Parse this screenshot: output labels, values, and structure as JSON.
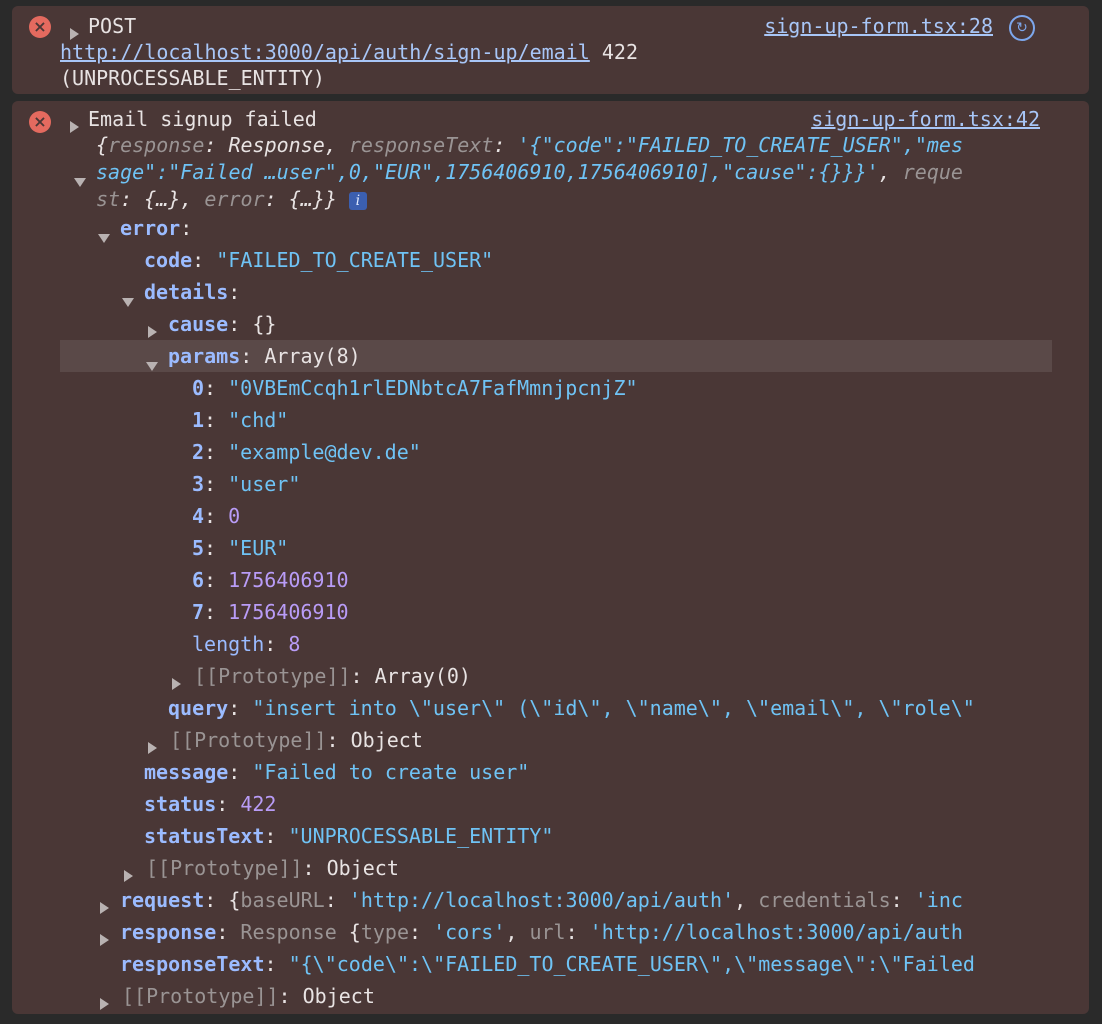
{
  "entries": [
    {
      "method": "POST",
      "source": "sign-up-form.tsx:28",
      "url": "http://localhost:3000/api/auth/sign-up/email",
      "status_code": "422",
      "status_text": "(UNPROCESSABLE_ENTITY)"
    },
    {
      "message": "Email signup failed",
      "source": "sign-up-form.tsx:42",
      "summary": {
        "l1_k1": "response",
        "l1_v1": "Response",
        "l1_k2": "responseText",
        "l1_v2": "'{\"code\":\"FAILED_TO_CREATE_USER\",\"mes",
        "l2_v": "sage\":\"Failed …user\",0,\"EUR\",1756406910,1756406910],\"cause\":{}}}'",
        "l2_k": "reque",
        "l3_k1": "st",
        "l3_k2": "error",
        "info_badge": "i"
      },
      "tree": {
        "error_key": "error",
        "code_key": "code",
        "code_val": "\"FAILED_TO_CREATE_USER\"",
        "details_key": "details",
        "cause_key": "cause",
        "cause_val": "{}",
        "params_key": "params",
        "params_val": "Array(8)",
        "params": [
          {
            "idx": "0",
            "val": "\"0VBEmCcqh1rlEDNbtcA7FafMmnjpcnjZ\"",
            "type": "str"
          },
          {
            "idx": "1",
            "val": "\"chd\"",
            "type": "str"
          },
          {
            "idx": "2",
            "val": "\"example@dev.de\"",
            "type": "str"
          },
          {
            "idx": "3",
            "val": "\"user\"",
            "type": "str"
          },
          {
            "idx": "4",
            "val": "0",
            "type": "num"
          },
          {
            "idx": "5",
            "val": "\"EUR\"",
            "type": "str"
          },
          {
            "idx": "6",
            "val": "1756406910",
            "type": "num"
          },
          {
            "idx": "7",
            "val": "1756406910",
            "type": "num"
          }
        ],
        "length_key": "length",
        "length_val": "8",
        "proto_key": "[[Prototype]]",
        "proto_array": "Array(0)",
        "proto_object": "Object",
        "query_key": "query",
        "query_val": "\"insert into \\\"user\\\" (\\\"id\\\", \\\"name\\\", \\\"email\\\", \\\"role\\\"",
        "message_key": "message",
        "message_val": "\"Failed to create user\"",
        "status_key": "status",
        "status_val": "422",
        "statusText_key": "statusText",
        "statusText_val": "\"UNPROCESSABLE_ENTITY\"",
        "request_key": "request",
        "request_k1": "baseURL",
        "request_v1": "'http://localhost:3000/api/auth'",
        "request_k2": "credentials",
        "request_v2": "'inc",
        "response_key": "response",
        "response_type": "Response",
        "response_k1": "type",
        "response_v1": "'cors'",
        "response_k2": "url",
        "response_v2": "'http://localhost:3000/api/auth",
        "responseText_key": "responseText",
        "responseText_val": "\"{\\\"code\\\":\\\"FAILED_TO_CREATE_USER\\\",\\\"message\\\":\\\"Failed"
      }
    }
  ]
}
